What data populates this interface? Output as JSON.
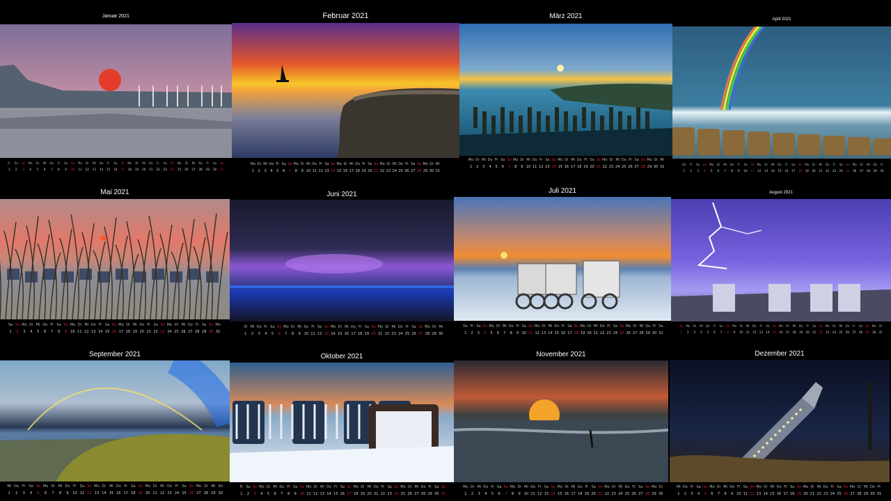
{
  "months": [
    {
      "title": "Januar 2021",
      "weekdays": [
        "Fr",
        "Sa",
        "So",
        "Mo",
        "Di",
        "Mi",
        "Do",
        "Fr",
        "Sa",
        "So",
        "Mo",
        "Di",
        "Mi",
        "Do",
        "Fr",
        "Sa",
        "So",
        "Mo",
        "Di",
        "Mi",
        "Do",
        "Fr",
        "Sa",
        "So",
        "Mo",
        "Di",
        "Mi",
        "Do",
        "Fr",
        "Sa",
        "So"
      ],
      "days": [
        "1",
        "2",
        "3",
        "4",
        "5",
        "6",
        "7",
        "8",
        "9",
        "10",
        "11",
        "12",
        "13",
        "14",
        "15",
        "16",
        "17",
        "18",
        "19",
        "20",
        "21",
        "22",
        "23",
        "24",
        "25",
        "26",
        "27",
        "28",
        "29",
        "30",
        "31"
      ]
    },
    {
      "title": "Februar 2021",
      "weekdays": [
        "Mo",
        "Di",
        "Mi",
        "Do",
        "Fr",
        "Sa",
        "So",
        "Mo",
        "Di",
        "Mi",
        "Do",
        "Fr",
        "Sa",
        "So",
        "Mo",
        "Di",
        "Mi",
        "Do",
        "Fr",
        "Sa",
        "So",
        "Mo",
        "Di",
        "Mi",
        "Do",
        "Fr",
        "Sa",
        "So"
      ],
      "days": [
        "1",
        "2",
        "3",
        "4",
        "5",
        "6",
        "7",
        "8",
        "9",
        "10",
        "11",
        "12",
        "13",
        "14",
        "15",
        "16",
        "17",
        "18",
        "19",
        "20",
        "21",
        "22",
        "23",
        "24",
        "25",
        "26",
        "27",
        "28"
      ]
    },
    {
      "title": "März 2021",
      "weekdays": [
        "Mo",
        "Di",
        "Mi",
        "Do",
        "Fr",
        "Sa",
        "So",
        "Mo",
        "Di",
        "Mi",
        "Do",
        "Fr",
        "Sa",
        "So",
        "Mo",
        "Di",
        "Mi",
        "Do",
        "Fr",
        "Sa",
        "So",
        "Mo",
        "Di",
        "Mi",
        "Do",
        "Fr",
        "Sa",
        "So",
        "Mo",
        "Di",
        "Mi"
      ],
      "days": [
        "1",
        "2",
        "3",
        "4",
        "5",
        "6",
        "7",
        "8",
        "9",
        "10",
        "11",
        "12",
        "13",
        "14",
        "15",
        "16",
        "17",
        "18",
        "19",
        "20",
        "21",
        "22",
        "23",
        "24",
        "25",
        "26",
        "27",
        "28",
        "29",
        "30",
        "31"
      ]
    },
    {
      "title": "April 2021",
      "weekdays": [
        "Do",
        "Fr",
        "Sa",
        "So",
        "Mo",
        "Di",
        "Mi",
        "Do",
        "Fr",
        "Sa",
        "So",
        "Mo",
        "Di",
        "Mi",
        "Do",
        "Fr",
        "Sa",
        "So",
        "Mo",
        "Di",
        "Mi",
        "Do",
        "Fr",
        "Sa",
        "So",
        "Mo",
        "Di",
        "Mi",
        "Do",
        "Fr"
      ],
      "days": [
        "1",
        "2",
        "3",
        "4",
        "5",
        "6",
        "7",
        "8",
        "9",
        "10",
        "11",
        "12",
        "13",
        "14",
        "15",
        "16",
        "17",
        "18",
        "19",
        "20",
        "21",
        "22",
        "23",
        "24",
        "25",
        "26",
        "27",
        "28",
        "29",
        "30"
      ]
    },
    {
      "title": "Mai 2021",
      "weekdays": [
        "Sa",
        "So",
        "Mo",
        "Di",
        "Mi",
        "Do",
        "Fr",
        "Sa",
        "So",
        "Mo",
        "Di",
        "Mi",
        "Do",
        "Fr",
        "Sa",
        "So",
        "Mo",
        "Di",
        "Mi",
        "Do",
        "Fr",
        "Sa",
        "So",
        "Mo",
        "Di",
        "Mi",
        "Do",
        "Fr",
        "Sa",
        "So",
        "Mo"
      ],
      "days": [
        "1",
        "2",
        "3",
        "4",
        "5",
        "6",
        "7",
        "8",
        "9",
        "10",
        "11",
        "12",
        "13",
        "14",
        "15",
        "16",
        "17",
        "18",
        "19",
        "20",
        "21",
        "22",
        "23",
        "24",
        "25",
        "26",
        "27",
        "28",
        "29",
        "30",
        "31"
      ]
    },
    {
      "title": "Juni 2021",
      "weekdays": [
        "Di",
        "Mi",
        "Do",
        "Fr",
        "Sa",
        "So",
        "Mo",
        "Di",
        "Mi",
        "Do",
        "Fr",
        "Sa",
        "So",
        "Mo",
        "Di",
        "Mi",
        "Do",
        "Fr",
        "Sa",
        "So",
        "Mo",
        "Di",
        "Mi",
        "Do",
        "Fr",
        "Sa",
        "So",
        "Mo",
        "Di",
        "Mi"
      ],
      "days": [
        "1",
        "2",
        "3",
        "4",
        "5",
        "6",
        "7",
        "8",
        "9",
        "10",
        "11",
        "12",
        "13",
        "14",
        "15",
        "16",
        "17",
        "18",
        "19",
        "20",
        "21",
        "22",
        "23",
        "24",
        "25",
        "26",
        "27",
        "28",
        "29",
        "30"
      ]
    },
    {
      "title": "Juli 2021",
      "weekdays": [
        "Do",
        "Fr",
        "Sa",
        "So",
        "Mo",
        "Di",
        "Mi",
        "Do",
        "Fr",
        "Sa",
        "So",
        "Mo",
        "Di",
        "Mi",
        "Do",
        "Fr",
        "Sa",
        "So",
        "Mo",
        "Di",
        "Mi",
        "Do",
        "Fr",
        "Sa",
        "So",
        "Mo",
        "Di",
        "Mi",
        "Do",
        "Fr",
        "Sa"
      ],
      "days": [
        "1",
        "2",
        "3",
        "4",
        "5",
        "6",
        "7",
        "8",
        "9",
        "10",
        "11",
        "12",
        "13",
        "14",
        "15",
        "16",
        "17",
        "18",
        "19",
        "20",
        "21",
        "22",
        "23",
        "24",
        "25",
        "26",
        "27",
        "28",
        "29",
        "30",
        "31"
      ]
    },
    {
      "title": "August 2021",
      "weekdays": [
        "So",
        "Mo",
        "Di",
        "Mi",
        "Do",
        "Fr",
        "Sa",
        "So",
        "Mo",
        "Di",
        "Mi",
        "Do",
        "Fr",
        "Sa",
        "So",
        "Mo",
        "Di",
        "Mi",
        "Do",
        "Fr",
        "Sa",
        "So",
        "Mo",
        "Di",
        "Mi",
        "Do",
        "Fr",
        "Sa",
        "So",
        "Mo",
        "Di"
      ],
      "days": [
        "1",
        "2",
        "3",
        "4",
        "5",
        "6",
        "7",
        "8",
        "9",
        "10",
        "11",
        "12",
        "13",
        "14",
        "15",
        "16",
        "17",
        "18",
        "19",
        "20",
        "21",
        "22",
        "23",
        "24",
        "25",
        "26",
        "27",
        "28",
        "29",
        "30",
        "31"
      ]
    },
    {
      "title": "September 2021",
      "weekdays": [
        "Mi",
        "Do",
        "Fr",
        "Sa",
        "So",
        "Mo",
        "Di",
        "Mi",
        "Do",
        "Fr",
        "Sa",
        "So",
        "Mo",
        "Di",
        "Mi",
        "Do",
        "Fr",
        "Sa",
        "So",
        "Mo",
        "Di",
        "Mi",
        "Do",
        "Fr",
        "Sa",
        "So",
        "Mo",
        "Di",
        "Mi",
        "Do"
      ],
      "days": [
        "1",
        "2",
        "3",
        "4",
        "5",
        "6",
        "7",
        "8",
        "9",
        "10",
        "11",
        "12",
        "13",
        "14",
        "15",
        "16",
        "17",
        "18",
        "19",
        "20",
        "21",
        "22",
        "23",
        "24",
        "25",
        "26",
        "27",
        "28",
        "29",
        "30"
      ]
    },
    {
      "title": "Oktober 2021",
      "weekdays": [
        "Fr",
        "Sa",
        "So",
        "Mo",
        "Di",
        "Mi",
        "Do",
        "Fr",
        "Sa",
        "So",
        "Mo",
        "Di",
        "Mi",
        "Do",
        "Fr",
        "Sa",
        "So",
        "Mo",
        "Di",
        "Mi",
        "Do",
        "Fr",
        "Sa",
        "So",
        "Mo",
        "Di",
        "Mi",
        "Do",
        "Fr",
        "Sa",
        "So"
      ],
      "days": [
        "1",
        "2",
        "3",
        "4",
        "5",
        "6",
        "7",
        "8",
        "9",
        "10",
        "11",
        "12",
        "13",
        "14",
        "15",
        "16",
        "17",
        "18",
        "19",
        "20",
        "21",
        "22",
        "23",
        "24",
        "25",
        "26",
        "27",
        "28",
        "29",
        "30",
        "31"
      ]
    },
    {
      "title": "November 2021",
      "weekdays": [
        "Mo",
        "Di",
        "Mi",
        "Do",
        "Fr",
        "Sa",
        "So",
        "Mo",
        "Di",
        "Mi",
        "Do",
        "Fr",
        "Sa",
        "So",
        "Mo",
        "Di",
        "Mi",
        "Do",
        "Fr",
        "Sa",
        "So",
        "Mo",
        "Di",
        "Mi",
        "Do",
        "Fr",
        "Sa",
        "So",
        "Mo",
        "Di"
      ],
      "days": [
        "1",
        "2",
        "3",
        "4",
        "5",
        "6",
        "7",
        "8",
        "9",
        "10",
        "11",
        "12",
        "13",
        "14",
        "15",
        "16",
        "17",
        "18",
        "19",
        "20",
        "21",
        "22",
        "23",
        "24",
        "25",
        "26",
        "27",
        "28",
        "29",
        "30"
      ]
    },
    {
      "title": "Dezember 2021",
      "weekdays": [
        "Mi",
        "Do",
        "Fr",
        "Sa",
        "So",
        "Mo",
        "Di",
        "Mi",
        "Do",
        "Fr",
        "Sa",
        "So",
        "Mo",
        "Di",
        "Mi",
        "Do",
        "Fr",
        "Sa",
        "So",
        "Mo",
        "Di",
        "Mi",
        "Do",
        "Fr",
        "Sa",
        "So",
        "Mo",
        "Di",
        "Mi",
        "Do",
        "Fr"
      ],
      "days": [
        "1",
        "2",
        "3",
        "4",
        "5",
        "6",
        "7",
        "8",
        "9",
        "10",
        "11",
        "12",
        "13",
        "14",
        "15",
        "16",
        "17",
        "18",
        "19",
        "20",
        "21",
        "22",
        "23",
        "24",
        "25",
        "26",
        "27",
        "28",
        "29",
        "30",
        "31"
      ]
    }
  ],
  "photos": [
    {
      "name": "sunset-promenade-photo",
      "scene": "promenade"
    },
    {
      "name": "sailboat-sunset-photo",
      "scene": "sailboat"
    },
    {
      "name": "groynes-sunset-photo",
      "scene": "groynes"
    },
    {
      "name": "rainbow-groynes-photo",
      "scene": "rainbow"
    },
    {
      "name": "dune-grass-sunset-photo",
      "scene": "dunegrass"
    },
    {
      "name": "night-storm-photo",
      "scene": "storm"
    },
    {
      "name": "bathing-carts-photo",
      "scene": "carts"
    },
    {
      "name": "lightning-beach-chairs-photo",
      "scene": "lightning"
    },
    {
      "name": "rainbow-dunes-photo",
      "scene": "dunerainbow"
    },
    {
      "name": "snowy-beach-chairs-photo",
      "scene": "snowchairs"
    },
    {
      "name": "kitesurfer-sunset-photo",
      "scene": "kitesurf"
    },
    {
      "name": "bottle-lights-photo",
      "scene": "bottle"
    }
  ]
}
